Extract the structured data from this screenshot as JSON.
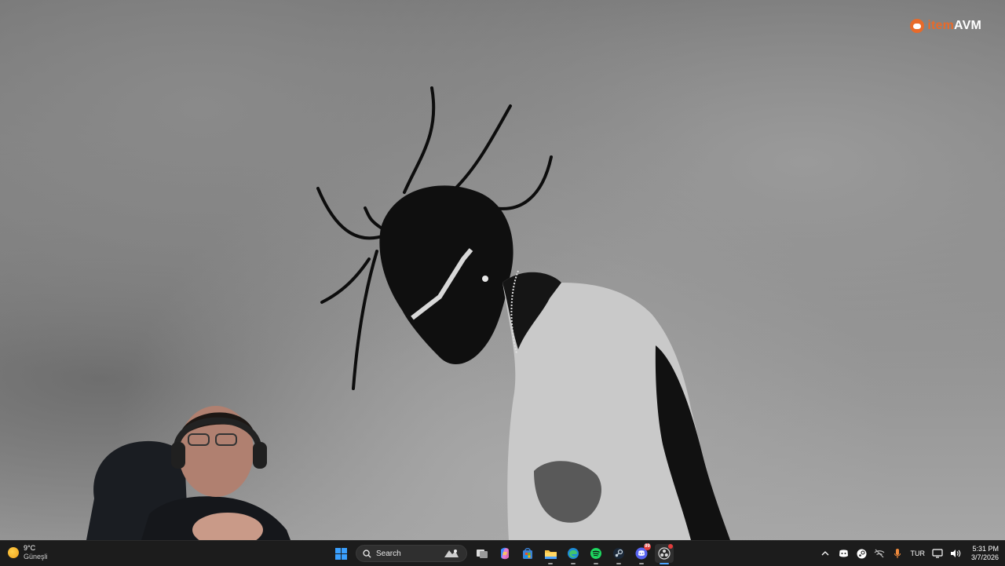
{
  "brand": {
    "part1": "item",
    "part2": "AVM",
    "accent_color": "#e86a2a"
  },
  "wallpaper": {
    "style": "grayscale smoke",
    "subject": "person-icon"
  },
  "webcam": {
    "icon": "person-icon"
  },
  "taskbar": {
    "weather": {
      "temperature": "9°C",
      "condition": "Güneşli",
      "icon": "sun-icon"
    },
    "search": {
      "label": "Search",
      "icon": "search-icon"
    },
    "pinned": [
      {
        "name": "start",
        "icon": "windows-logo-icon"
      },
      {
        "name": "task-view",
        "icon": "task-view-icon"
      },
      {
        "name": "copilot",
        "icon": "copilot-icon"
      },
      {
        "name": "store",
        "icon": "store-icon"
      },
      {
        "name": "file-explorer",
        "icon": "folder-icon"
      },
      {
        "name": "edge",
        "icon": "edge-icon"
      },
      {
        "name": "spotify",
        "icon": "spotify-icon"
      },
      {
        "name": "steam",
        "icon": "steam-icon"
      },
      {
        "name": "discord",
        "icon": "discord-icon",
        "badge": "99"
      },
      {
        "name": "obs",
        "icon": "obs-icon"
      }
    ],
    "tray": {
      "language": "TUR",
      "time": "5:31 PM",
      "date": "3/7/2026"
    }
  }
}
